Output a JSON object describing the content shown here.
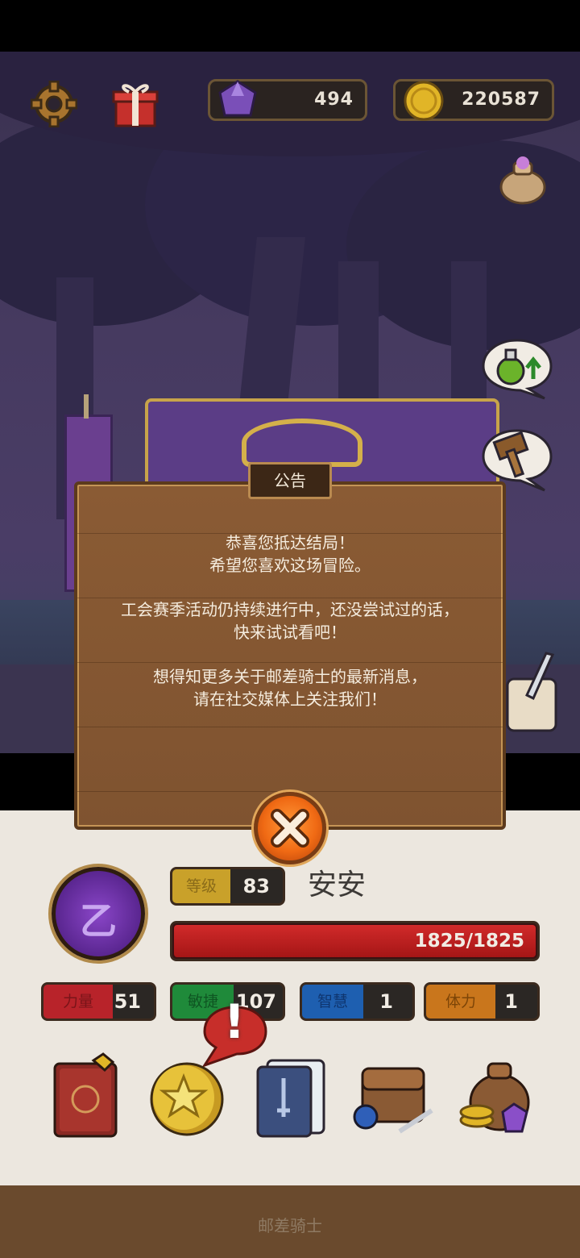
{
  "currency": {
    "gems": "494",
    "coins": "220587"
  },
  "dialog": {
    "title": "公告",
    "lines": [
      "恭喜您抵达结局！",
      "希望您喜欢这场冒险。",
      "工会赛季活动仍持续进行中，还没尝试过的话，",
      "快来试试看吧！",
      "想得知更多关于邮差骑士的最新消息，",
      "请在社交媒体上关注我们！"
    ]
  },
  "player": {
    "level_label": "等级",
    "level": "83",
    "name": "安安",
    "hp_text": "1825/1825",
    "hp_fraction": 1.0,
    "emblem_glyph": "乙"
  },
  "stats": [
    {
      "label": "力量",
      "value": "51",
      "color": "#b8232a"
    },
    {
      "label": "敏捷",
      "value": "107",
      "color": "#1f8a3a"
    },
    {
      "label": "智慧",
      "value": "1",
      "color": "#1e5fb0"
    },
    {
      "label": "体力",
      "value": "1",
      "color": "#c9761c"
    }
  ],
  "alert_glyph": "!",
  "footer_title": "邮差骑士",
  "icons": [
    "gear-icon",
    "gift-icon",
    "gem-icon",
    "coin-icon",
    "bag-icon",
    "potion-upgrade-icon",
    "hammer-icon",
    "sword-icon",
    "close-icon",
    "journal-icon",
    "star-coin-icon",
    "cards-icon",
    "backpack-icon",
    "loot-bag-icon"
  ]
}
